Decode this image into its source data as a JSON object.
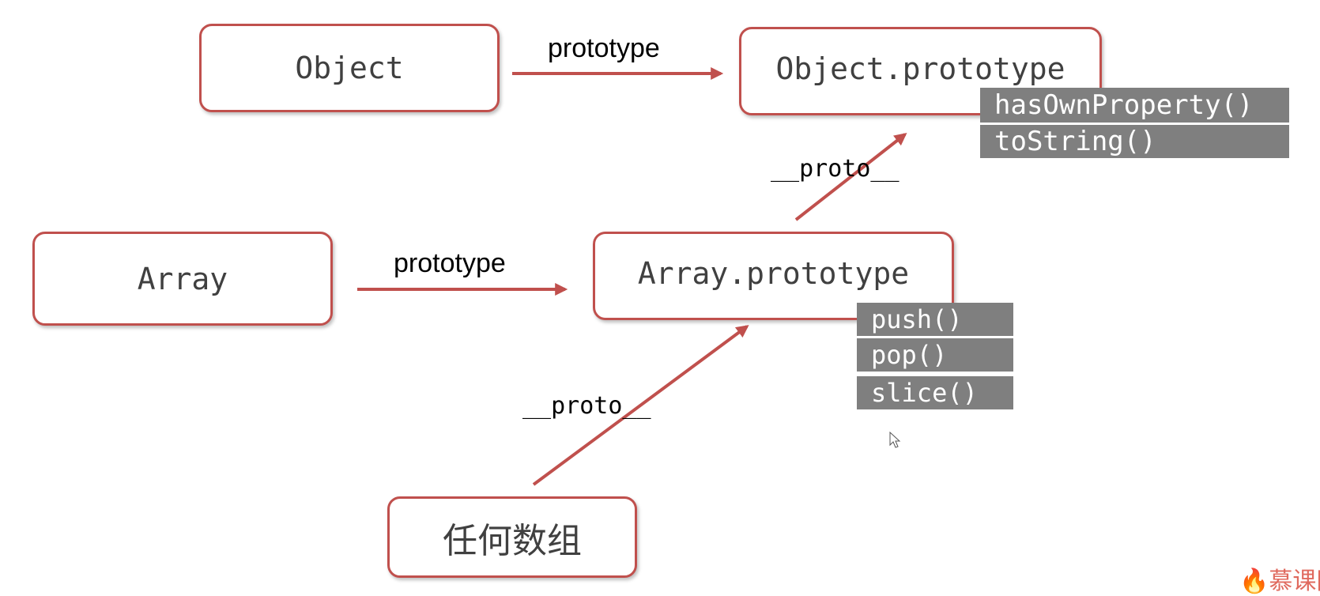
{
  "nodes": {
    "object": "Object",
    "object_prototype": "Object.prototype",
    "array": "Array",
    "array_prototype": "Array.prototype",
    "any_array": "任何数组"
  },
  "edges": {
    "object_to_prototype": "prototype",
    "array_to_prototype": "prototype",
    "array_proto_to_object_proto": "__proto__",
    "any_array_to_array_proto": "__proto__"
  },
  "object_prototype_methods": [
    "hasOwnProperty()",
    "toString()"
  ],
  "array_prototype_methods": [
    "push()",
    "pop()",
    "slice()"
  ],
  "watermark": "慕课网",
  "colors": {
    "border": "#c0504d",
    "arrow": "#c0504d",
    "method_bg": "#7f7f7f",
    "node_text": "#404040"
  }
}
